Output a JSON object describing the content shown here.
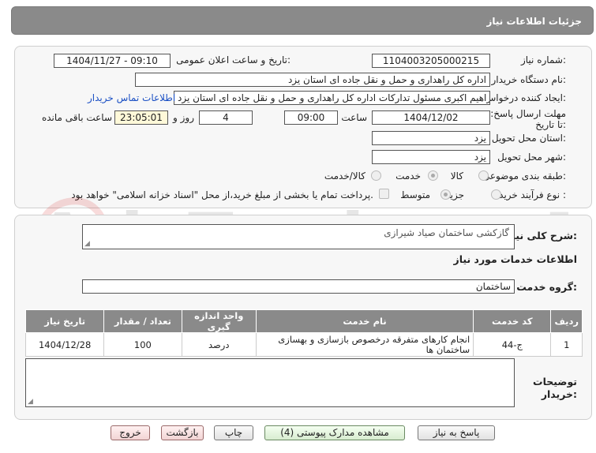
{
  "header": {
    "title": "جزئیات اطلاعات نیاز"
  },
  "fields": {
    "need_number_label": "شماره نیاز:",
    "need_number": "1104003205000215",
    "announce_label": "تاریخ و ساعت اعلان عمومی:",
    "announce_value": "1404/11/27 - 09:10",
    "buyer_org_label": "نام دستگاه خریدار:",
    "buyer_org": "اداره کل راهداری و حمل و نقل جاده ای استان یزد",
    "requester_label": "ایجاد کننده درخواست:",
    "requester": "ابراهیم اکبری مسئول تدارکات اداره کل راهداری و حمل و نقل جاده ای استان یزد",
    "contact_link": "اطلاعات تماس خریدار",
    "deadline_label": "مهلت ارسال پاسخ: تا تاریخ:",
    "deadline_date": "1404/12/02",
    "time_label": "ساعت",
    "deadline_time": "09:00",
    "days_value": "4",
    "days_label": "روز و",
    "remaining_time": "23:05:01",
    "remaining_label": "ساعت باقی مانده",
    "province_label": "استان محل تحویل:",
    "province": "یزد",
    "city_label": "شهر محل تحویل:",
    "city": "یزد",
    "category_label": "طبقه بندی موضوعی:",
    "category_options": [
      "کالا",
      "خدمت",
      "کالا/خدمت"
    ],
    "process_label": "نوع فرآیند خرید :",
    "process_options": [
      "جزیی",
      "متوسط"
    ],
    "payment_note": "پرداخت تمام یا بخشی از مبلغ خرید،از محل \"اسناد خزانه اسلامی\" خواهد بود."
  },
  "section2": {
    "general_desc_label": "شرح کلی نیاز:",
    "general_desc": "گازکشی ساختمان صیاد شیرازی",
    "services_title": "اطلاعات خدمات مورد نیاز",
    "service_group_label": "گروه خدمت:",
    "service_group": "ساختمان",
    "table": {
      "headers": [
        "ردیف",
        "کد خدمت",
        "نام خدمت",
        "واحد اندازه گیری",
        "تعداد / مقدار",
        "تاریخ نیاز"
      ],
      "rows": [
        [
          "1",
          "ج-44",
          "انجام کارهای متفرقه درخصوص بازسازی و بهسازی ساختمان ها",
          "درصد",
          "100",
          "1404/12/28"
        ]
      ]
    },
    "buyer_notes_label": "توضیحات خریدار:"
  },
  "watermark": {
    "text": "AriaTender.neT"
  },
  "buttons": {
    "reply": "پاسخ به نیاز",
    "attachments": "مشاهده مدارک پیوستی (4)",
    "print": "چاپ",
    "back": "بازگشت",
    "exit": "خروج"
  },
  "colors": {
    "header_bg": "#8a8a8a",
    "link": "#1a4fc4",
    "remaining_bg": "#fff9d9"
  }
}
